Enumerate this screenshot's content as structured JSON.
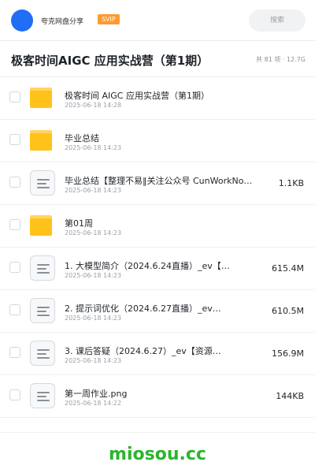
{
  "header": {
    "share_name": "夸克网盘分享",
    "badge": "SVIP",
    "search_placeholder": "搜索"
  },
  "page": {
    "title": "极客时间AIGC 应用实战营（第1期）",
    "meta": "共 81 项 · 12.7G"
  },
  "files": [
    {
      "type": "folder",
      "name": "极客时间 AIGC 应用实战营（第1期）",
      "date": "2025-06-18 14:28",
      "size": ""
    },
    {
      "type": "folder",
      "name": "毕业总结",
      "date": "2025-06-18 14:23",
      "size": ""
    },
    {
      "type": "doc",
      "name": "毕业总结【整理不易‖关注公众号 CunWorkNo…",
      "date": "2025-06-18 14:23",
      "size": "1.1KB"
    },
    {
      "type": "folder",
      "name": "第01周",
      "date": "2025-06-18 14:23",
      "size": ""
    },
    {
      "type": "doc",
      "name": "1. 大模型简介（2024.6.24直播）_ev【…",
      "date": "2025-06-18 14:23",
      "size": "615.4M"
    },
    {
      "type": "doc",
      "name": "2. 提示词优化（2024.6.27直播）_ev…",
      "date": "2025-06-18 14:23",
      "size": "610.5M"
    },
    {
      "type": "doc",
      "name": "3. 课后答疑（2024.6.27）_ev【资源…",
      "date": "2025-06-18 14:23",
      "size": "156.9M"
    },
    {
      "type": "doc",
      "name": "第一周作业.png",
      "date": "2025-06-18 14:22",
      "size": "144KB"
    }
  ],
  "watermark": "miosou.cc",
  "colors": {
    "accent": "#1f6ef5",
    "svip": "#ff9a2e",
    "folder": "#ffc21a",
    "watermark": "#2bb52b"
  }
}
